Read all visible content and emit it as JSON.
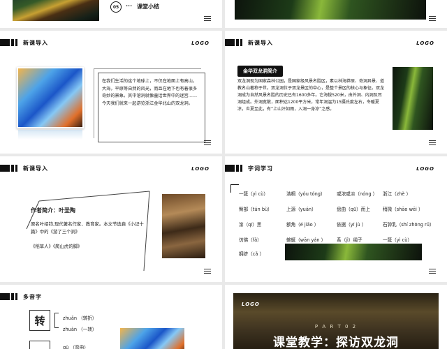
{
  "slide_top_left": {
    "number": "05",
    "dots": "···",
    "title": "课堂小结"
  },
  "logo": "LOGO",
  "slide_intro": {
    "header": "新课导入",
    "paragraph": "在我们生活的这个地球上，不仅在地面上有高山，大海，平原等自然的风光，而且在地下也有着很多奇妙的景象。其中溶洞就像童话世界中的迷宫……今天我们就来一起游览浙江金华北山的双龙洞。"
  },
  "slide_cave": {
    "header": "新课导入",
    "pill": "金华双龙洞简介",
    "paragraph": "双龙洞现为国家森林公园，是国家级风景名胜区，素以林海莽原、奇洞异景、道教名山著称于世。双龙洞位于双龙景区的中心，是整个景区的核心与象征。双龙洞成为自然风景名胜的历史已有1600多年。它海拔520米，由外洞、内洞及耳洞组成。外洞宽敞，面积达1200平方米，常年洞温为15摄氏度左右，冬暖夏凉，炎夏至此，有“上山汗如雨，入洞一身凉”之感。"
  },
  "slide_author": {
    "header": "新课导入",
    "title": "作者简介：叶圣陶",
    "bio": "原名叶绍钧,现代著名作家、教育家。本文节选自《小记十篇》中的《游了三个洞》",
    "works": "《稻草人》《爬山虎的脚》"
  },
  "slide_vocab": {
    "header": "字词学习",
    "items": [
      "一簇（yì cù）",
      "浩桐（yóu tóng）",
      "或浓或淡（nóng ）",
      "浙江（zhè ）",
      "臀部（tún bù）",
      "上源（yuán）",
      "盘曲（qū）而上",
      "稍微（shāo  wēi ）",
      "漆（qī）黑",
      "额角（é jiǎo ）",
      "依据（yī jù ）",
      "石钟乳（shí zhōng rǔ）",
      "仿佛（fǎ）",
      "蜿蜒（wān yán ）",
      "系（jì）绳子",
      "一簇（yì cù）",
      "拥挤（cǎ ）"
    ]
  },
  "slide_poly": {
    "header": "多音字",
    "char": "转",
    "readings": [
      "zhuǎn  （转折）",
      "zhuàn  （一转）"
    ],
    "reading3": "qū       （弯曲）"
  },
  "slide_part": {
    "logo": "LOGO",
    "part": "P A R T   0 2",
    "title": "课堂教学：探访双龙洞"
  }
}
